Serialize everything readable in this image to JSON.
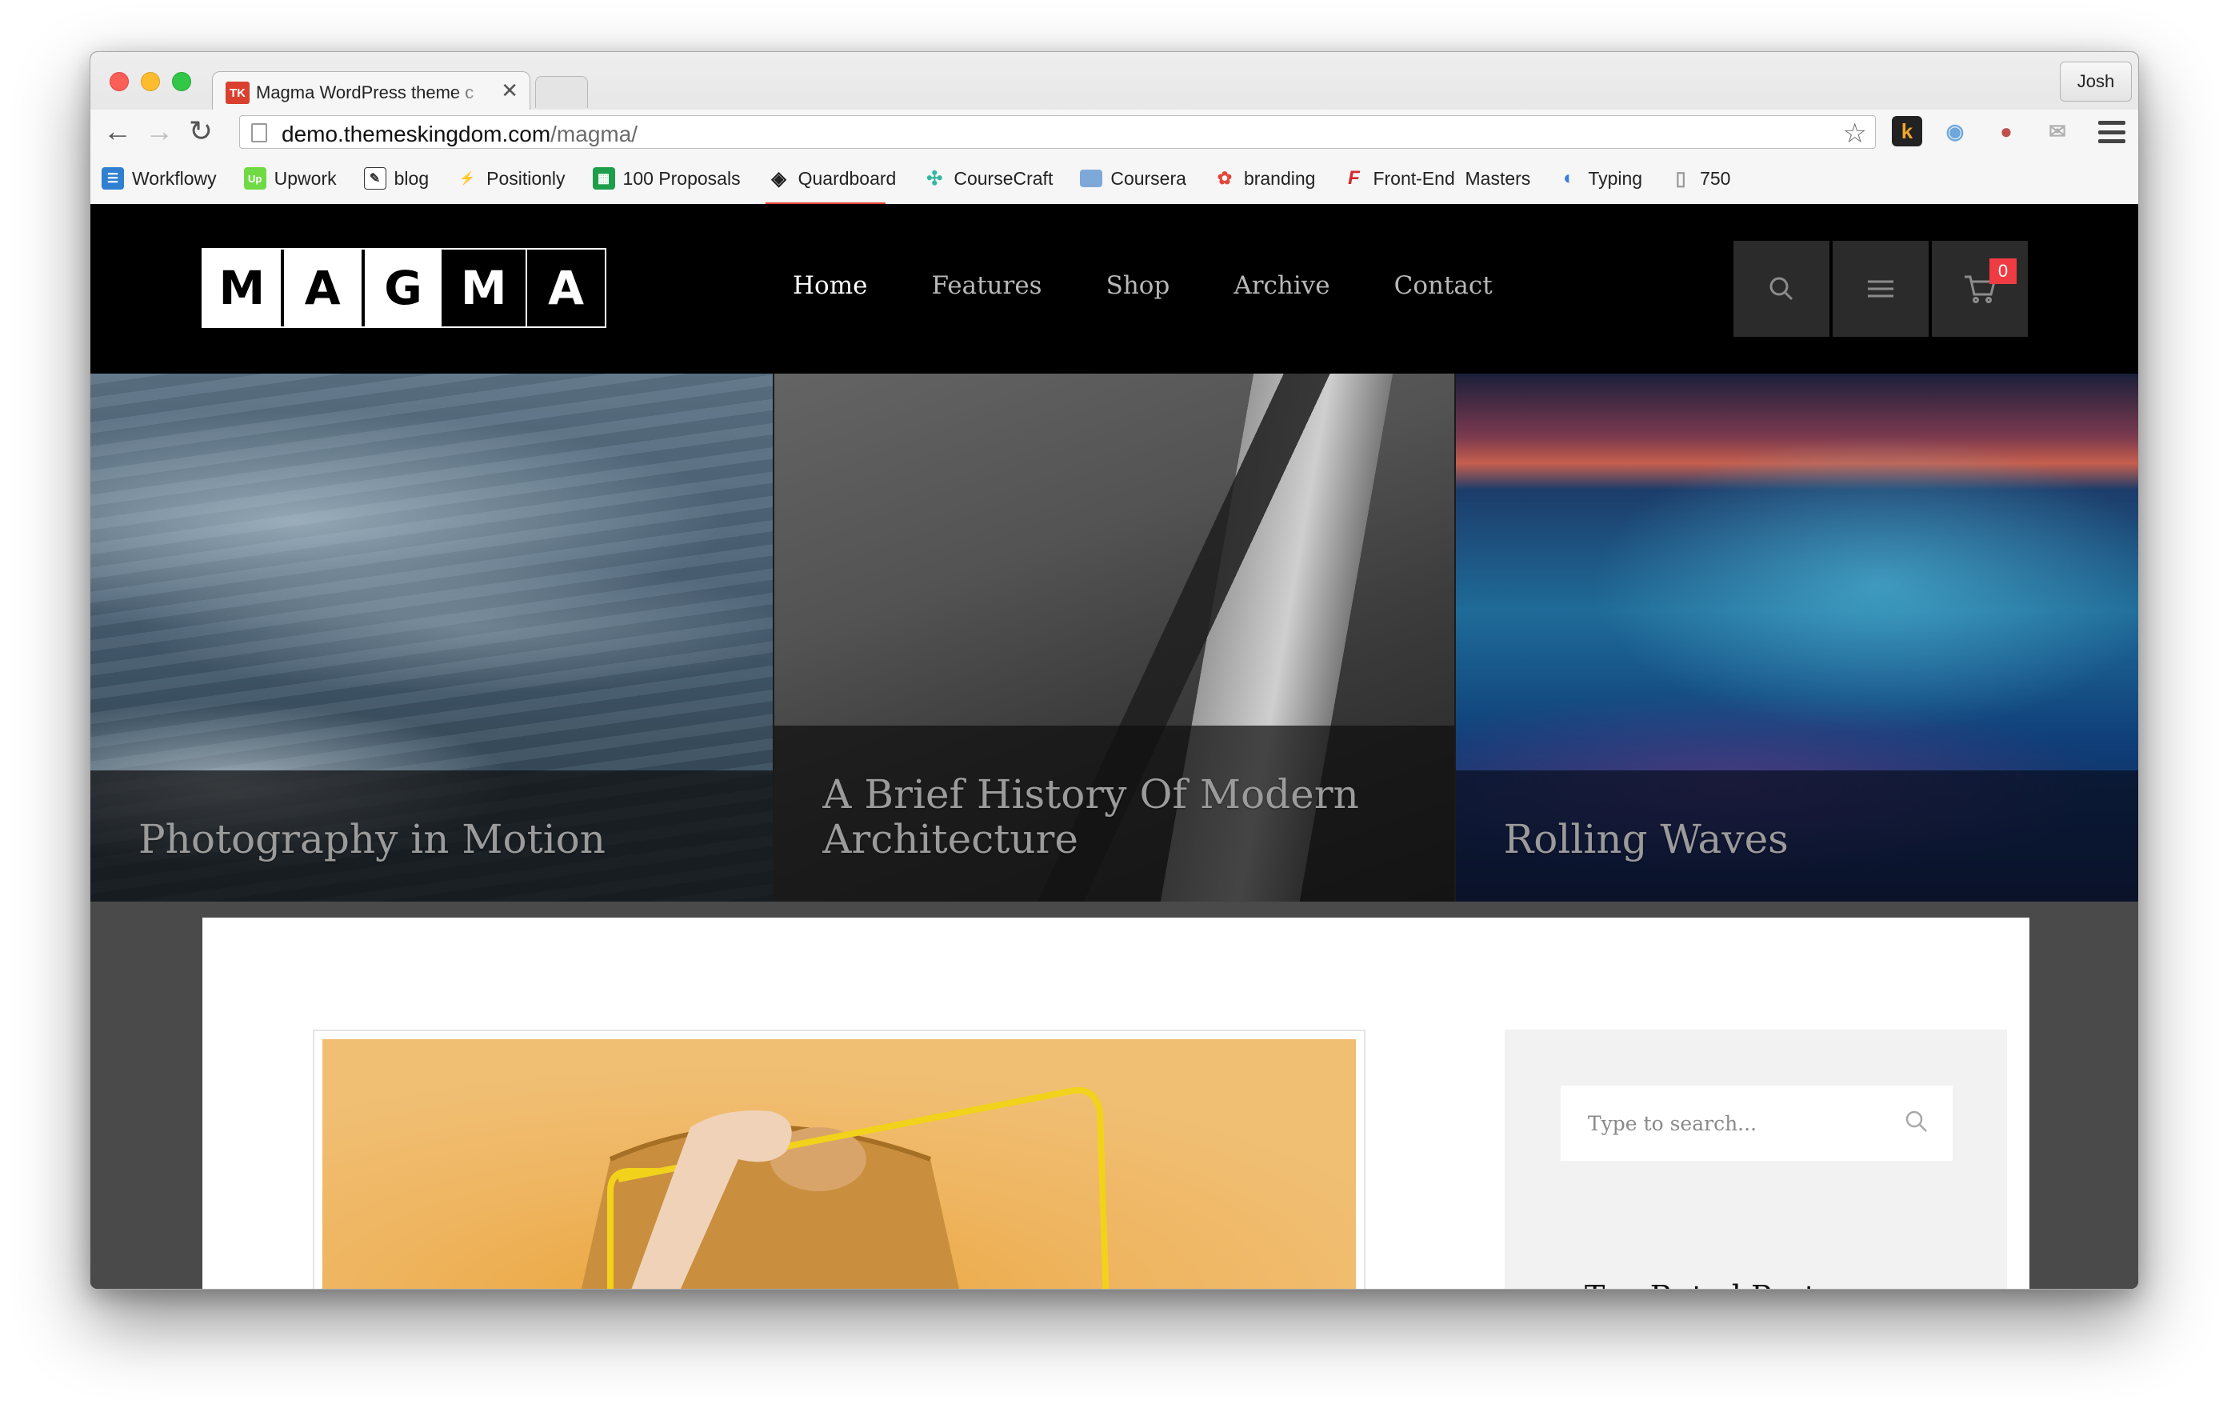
{
  "browser": {
    "tab": {
      "favicon_text": "TK",
      "title": "Magma WordPress theme c",
      "close_glyph": "✕"
    },
    "profile_name": "Josh",
    "address": {
      "host": "demo.themeskingdom.com",
      "path": "/magma/"
    },
    "nav": {
      "back": "←",
      "forward": "→",
      "reload": "↻"
    },
    "extensions": [
      {
        "name": "k-extension",
        "glyph": "k",
        "color": "#f0a52b"
      },
      {
        "name": "camera-extension",
        "glyph": "◉",
        "color": "#6fa8dc"
      },
      {
        "name": "tomato-extension",
        "glyph": "●",
        "color": "#c0504d"
      },
      {
        "name": "mail-extension",
        "glyph": "✉",
        "color": "#b0b0b0"
      }
    ],
    "bookmarks": [
      {
        "label": "Workflowy",
        "icon": "workflowy-icon",
        "glyph": "☰",
        "color": "#2f80d1"
      },
      {
        "label": "Upwork",
        "icon": "upwork-icon",
        "glyph": "Up",
        "color": "#6fda44"
      },
      {
        "label": "blog",
        "icon": "blog-icon",
        "glyph": "✎",
        "color": "#333333"
      },
      {
        "label": "Positionly",
        "icon": "positionly-icon",
        "glyph": "⚡",
        "color": "#4caf50"
      },
      {
        "label": "100 Proposals",
        "icon": "sheet-icon",
        "glyph": "▦",
        "color": "#1e9e4a"
      },
      {
        "label": "Quardboard",
        "icon": "quardboard-icon",
        "glyph": "◈",
        "color": "#222222"
      },
      {
        "label": "CourseCraft",
        "icon": "coursecraft-icon",
        "glyph": "✣",
        "color": "#35b6a0"
      },
      {
        "label": "Coursera",
        "icon": "folder-icon",
        "glyph": "▬",
        "color": "#7ea8d8"
      },
      {
        "label": "branding",
        "icon": "branding-icon",
        "glyph": "✿",
        "color": "#e2463c"
      },
      {
        "label": "Front-End  Masters",
        "icon": "frontend-masters-icon",
        "glyph": "F",
        "color": "#d7262c"
      },
      {
        "label": "Typing",
        "icon": "typing-icon",
        "glyph": "◐",
        "color": "#3a7bd5"
      },
      {
        "label": "750",
        "icon": "page-icon",
        "glyph": "▯",
        "color": "#9a9a9a"
      }
    ]
  },
  "site": {
    "logo_letters": [
      "M",
      "A",
      "G",
      "M",
      "A"
    ],
    "nav": [
      {
        "label": "Home",
        "active": true
      },
      {
        "label": "Features",
        "active": false
      },
      {
        "label": "Shop",
        "active": false
      },
      {
        "label": "Archive",
        "active": false
      },
      {
        "label": "Contact",
        "active": false
      }
    ],
    "cart_count": "0",
    "slides": [
      {
        "title": "Photography in Motion"
      },
      {
        "title": "A Brief History Of Modern Architecture"
      },
      {
        "title": "Rolling Waves"
      }
    ],
    "sidebar": {
      "search_placeholder": "Type to search...",
      "widget_title": "Top Rated Posts"
    }
  }
}
